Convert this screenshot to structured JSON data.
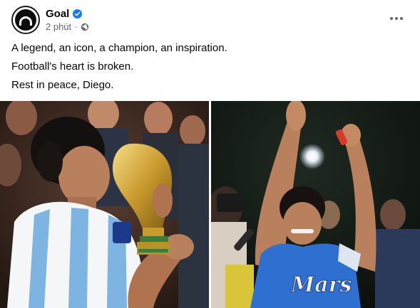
{
  "post": {
    "page_name": "Goal",
    "timestamp": "2 phút",
    "separator": "·",
    "lines": [
      "A legend, an icon, a champion, an inspiration.",
      "Football's heart is broken.",
      "Rest in peace, Diego."
    ]
  },
  "icons": {
    "verified": "verified-badge-icon",
    "privacy": "globe-icon",
    "more": "more-options-icon"
  },
  "photos": [
    {
      "subject": "player kissing World Cup trophy",
      "jersey_colors": [
        "#74acdf",
        "#ffffff"
      ]
    },
    {
      "subject": "player celebrating with raised arms",
      "jersey_text": "Mars",
      "jersey_color": "#2f6fd0"
    }
  ],
  "colors": {
    "verified": "#1877f2",
    "secondary_text": "#65676b",
    "text": "#050505"
  }
}
